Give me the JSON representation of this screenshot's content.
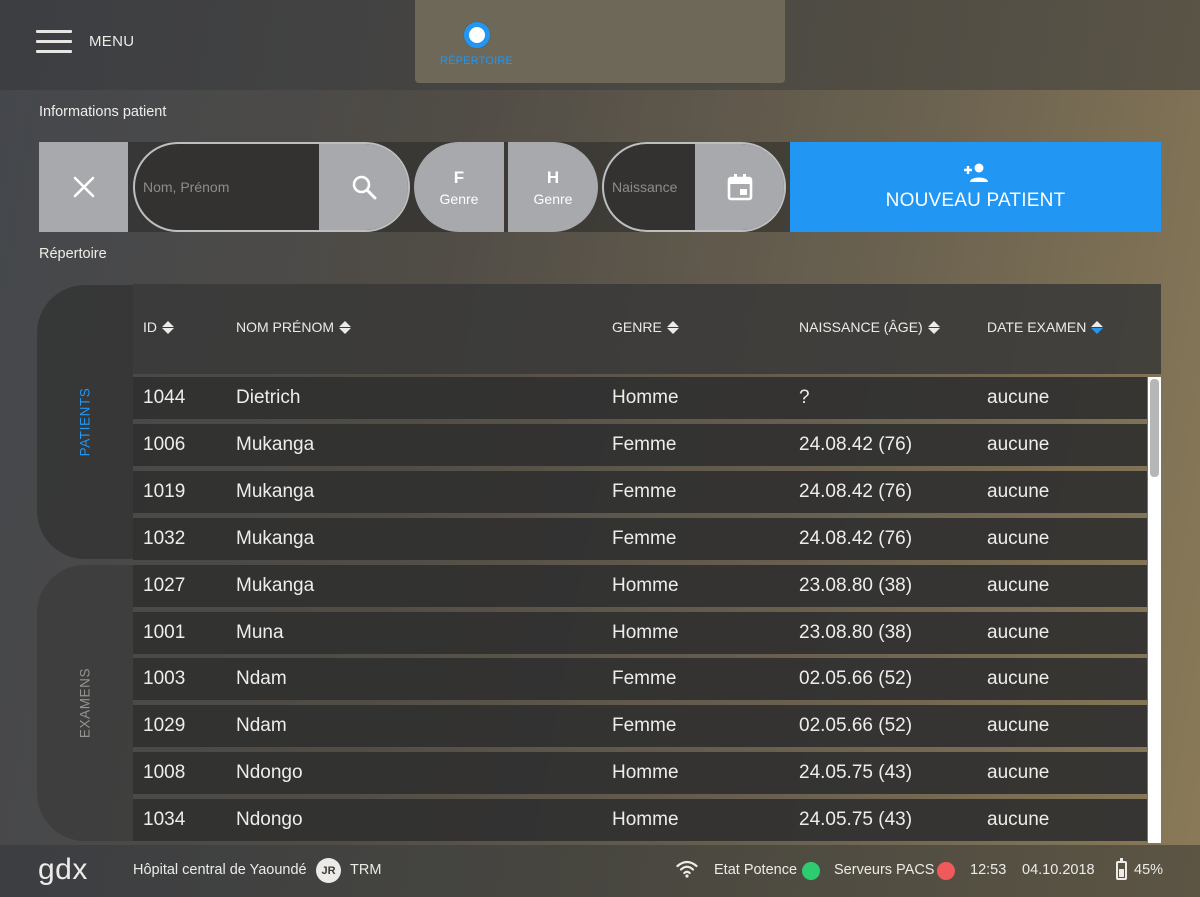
{
  "header": {
    "menu_label": "MENU",
    "nav_tab_label": "RÉPERTOIRE"
  },
  "sections": {
    "patient_info_label": "Informations patient",
    "directory_label": "Répertoire"
  },
  "filters": {
    "name_placeholder": "Nom, Prénom",
    "name_value": "",
    "gender_f_letter": "F",
    "gender_f_sub": "Genre",
    "gender_h_letter": "H",
    "gender_h_sub": "Genre",
    "birth_placeholder": "Naissance",
    "birth_value": "",
    "new_patient_label": "NOUVEAU PATIENT"
  },
  "side_tabs": {
    "patients": "PATIENTS",
    "examens": "EXAMENS",
    "active": "patients"
  },
  "table": {
    "headers": {
      "id": "ID",
      "name": "NOM PRÉNOM",
      "genre": "GENRE",
      "birth": "NAISSANCE (ÂGE)",
      "exam_date": "DATE EXAMEN"
    },
    "active_sort": "exam_date",
    "rows": [
      {
        "id": "1044",
        "name": "Dietrich",
        "genre": "Homme",
        "birth": "?",
        "exam_date": "aucune"
      },
      {
        "id": "1006",
        "name": "Mukanga",
        "genre": "Femme",
        "birth": "24.08.42 (76)",
        "exam_date": "aucune"
      },
      {
        "id": "1019",
        "name": "Mukanga",
        "genre": "Femme",
        "birth": "24.08.42 (76)",
        "exam_date": "aucune"
      },
      {
        "id": "1032",
        "name": "Mukanga",
        "genre": "Femme",
        "birth": "24.08.42 (76)",
        "exam_date": "aucune"
      },
      {
        "id": "1027",
        "name": "Mukanga",
        "genre": "Homme",
        "birth": "23.08.80 (38)",
        "exam_date": "aucune"
      },
      {
        "id": "1001",
        "name": "Muna",
        "genre": "Homme",
        "birth": "23.08.80 (38)",
        "exam_date": "aucune"
      },
      {
        "id": "1003",
        "name": "Ndam",
        "genre": "Femme",
        "birth": "02.05.66 (52)",
        "exam_date": "aucune"
      },
      {
        "id": "1029",
        "name": "Ndam",
        "genre": "Femme",
        "birth": "02.05.66 (52)",
        "exam_date": "aucune"
      },
      {
        "id": "1008",
        "name": "Ndongo",
        "genre": "Homme",
        "birth": "24.05.75 (43)",
        "exam_date": "aucune"
      },
      {
        "id": "1034",
        "name": "Ndongo",
        "genre": "Homme",
        "birth": "24.05.75 (43)",
        "exam_date": "aucune"
      }
    ]
  },
  "footer": {
    "logo": "gdx",
    "hospital": "Hôpital central de Yaoundé",
    "user_initials": "JR",
    "user_role": "TRM",
    "potence_label": "Etat Potence",
    "pacs_label": "Serveurs PACS",
    "time": "12:53",
    "date": "04.10.2018",
    "battery": "45%"
  },
  "colors": {
    "accent": "#2196f3",
    "status_ok": "#2ecc71",
    "status_error": "#f05a5a"
  },
  "icons": {
    "menu": "hamburger-icon",
    "clear": "close-icon",
    "search": "search-icon",
    "calendar": "calendar-icon",
    "new_patient": "person-add-icon",
    "wifi": "wifi-icon",
    "battery": "battery-icon"
  }
}
